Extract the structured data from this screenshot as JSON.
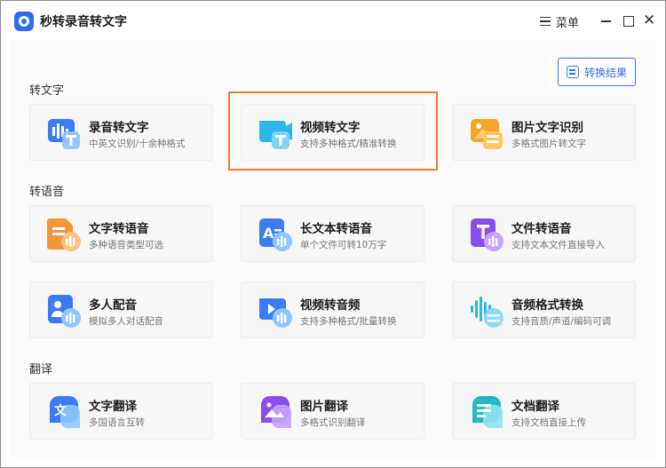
{
  "app": {
    "title": "秒转录音转文字"
  },
  "titlebar": {
    "menu_label": "菜单",
    "close_glyph": "✕"
  },
  "toolbar": {
    "result_label": "转换结果"
  },
  "sections": {
    "text": {
      "title": "转文字"
    },
    "speech": {
      "title": "转语音"
    },
    "translate": {
      "title": "翻译"
    }
  },
  "cards": {
    "audio_to_text": {
      "name": "录音转文字",
      "desc": "中英文识别/十余种格式"
    },
    "video_to_text": {
      "name": "视频转文字",
      "desc": "支持多种格式/精准转换"
    },
    "image_text_ocr": {
      "name": "图片文字识别",
      "desc": "多格式图片转文字"
    },
    "text_to_speech": {
      "name": "文字转语音",
      "desc": "多种语音类型可选"
    },
    "long_text_to_speech": {
      "name": "长文本转语音",
      "desc": "单个文件可转10万字"
    },
    "file_to_speech": {
      "name": "文件转语音",
      "desc": "支持文本文件直接导入"
    },
    "multi_dubbing": {
      "name": "多人配音",
      "desc": "模拟多人对话配音"
    },
    "video_to_audio": {
      "name": "视频转音频",
      "desc": "支持多种格式/批量转换"
    },
    "audio_format": {
      "name": "音频格式转换",
      "desc": "支持音质/声道/编码可调"
    },
    "text_translate": {
      "name": "文字翻译",
      "desc": "多国语言互转"
    },
    "image_translate": {
      "name": "图片翻译",
      "desc": "多格式识别翻译"
    },
    "doc_translate": {
      "name": "文档翻译",
      "desc": "支持文档直接上传"
    }
  },
  "icons": {
    "text_glyph": "文",
    "t_glyph": "T",
    "a_glyph": "A"
  },
  "colors": {
    "accent": "#2f6bf2",
    "highlight": "#ee7a2c"
  }
}
